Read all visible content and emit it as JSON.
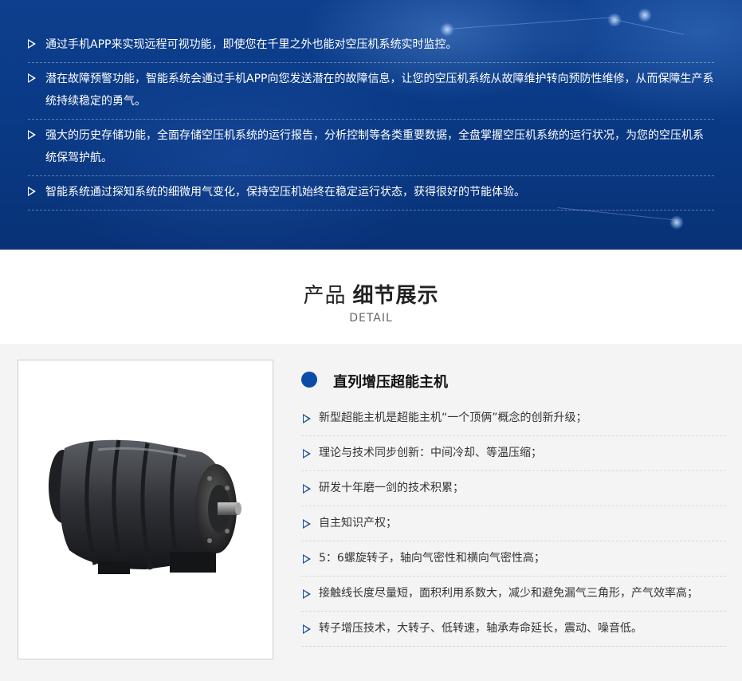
{
  "banner": {
    "items": [
      "通过手机APP来实现远程可视功能，即使您在千里之外也能对空压机系统实时监控。",
      "潜在故障预警功能，智能系统会通过手机APP向您发送潜在的故障信息，让您的空压机系统从故障维护转向预防性维修，从而保障生产系统持续稳定的勇气。",
      "强大的历史存储功能，全面存储空压机系统的运行报告，分析控制等各类重要数据，全盘掌握空压机系统的运行状况，为您的空压机系统保驾护航。",
      "智能系统通过探知系统的细微用气变化，保持空压机始终在稳定运行状态，获得很好的节能体验。"
    ]
  },
  "section": {
    "title_light": "产品",
    "title_bold": "细节展示",
    "subtitle": "DETAIL"
  },
  "product": {
    "name": "直列增压超能主机",
    "features": [
      "新型超能主机是超能主机“一个顶俩”概念的创新升级；",
      "理论与技术同步创新：中间冷却、等温压缩；",
      "研发十年磨一剑的技术积累；",
      "自主知识产权；",
      "5：6螺旋转子，轴向气密性和横向气密性高；",
      "接触线长度尽量短，面积利用系数大，减少和避免漏气三角形，产气效率高；",
      "转子增压技术，大转子、低转速，轴承寿命延长，震动、噪音低。"
    ]
  },
  "colors": {
    "banner_blue": "#0a3a86",
    "accent_blue": "#0c4ca8"
  }
}
